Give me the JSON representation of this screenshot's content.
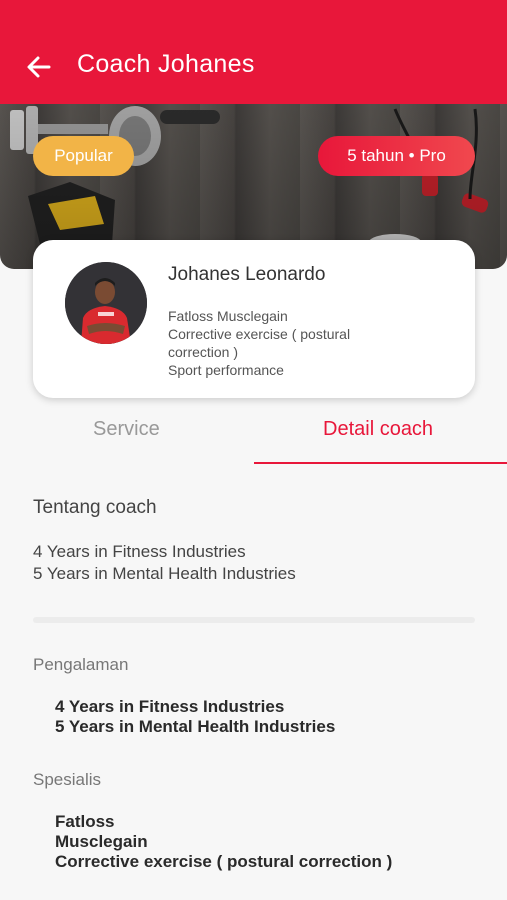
{
  "header": {
    "title": "Coach Johanes"
  },
  "hero": {
    "badge_popular": "Popular",
    "badge_experience": "5 tahun • Pro"
  },
  "profile": {
    "name": "Johanes Leonardo",
    "specialties": [
      "Fatloss   Musclegain",
      "Corrective exercise ( postural",
      "correction )",
      "Sport performance"
    ]
  },
  "tabs": [
    {
      "label": "Service"
    },
    {
      "label": "Detail coach"
    }
  ],
  "about": {
    "title": "Tentang coach",
    "lines": [
      "4 Years in Fitness Industries",
      "5 Years in Mental Health Industries"
    ]
  },
  "experience": {
    "label": "Pengalaman",
    "lines": [
      "4 Years in Fitness Industries",
      "5 Years in Mental Health Industries"
    ]
  },
  "specialist": {
    "label": "Spesialis",
    "lines": [
      "Fatloss",
      "Musclegain",
      "Corrective exercise ( postural correction )"
    ]
  },
  "colors": {
    "primary": "#e8173a",
    "badge_popular": "#f2b447"
  }
}
